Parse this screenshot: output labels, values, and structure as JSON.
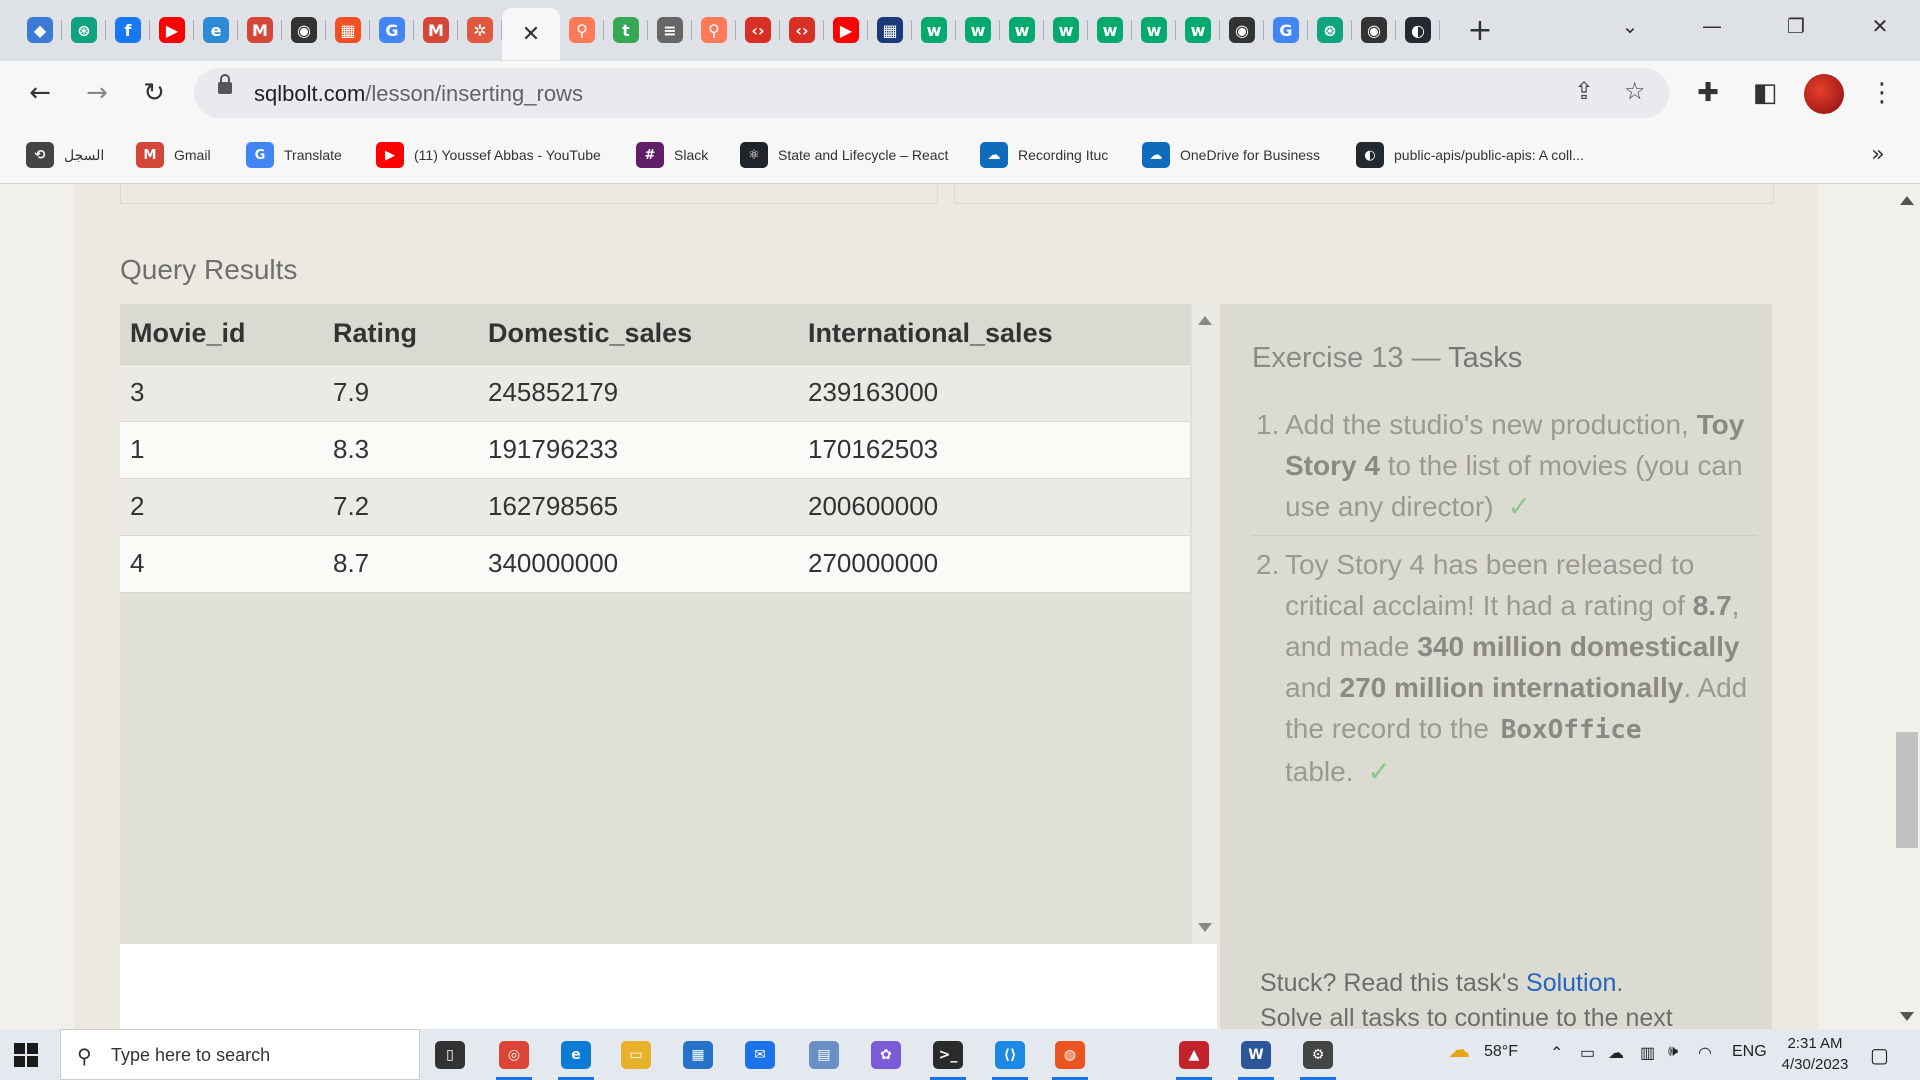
{
  "browser": {
    "tabs": [
      {
        "icon": "openai-icon",
        "color": "#3b7bd4",
        "glyph": "◆"
      },
      {
        "icon": "chatgpt-icon",
        "color": "#10a37f",
        "glyph": "⊛"
      },
      {
        "icon": "facebook-icon",
        "color": "#1877f2",
        "glyph": "f"
      },
      {
        "icon": "youtube-icon",
        "color": "#ff0000",
        "glyph": "▶"
      },
      {
        "icon": "edge-icon",
        "color": "#2d8bd6",
        "glyph": "e"
      },
      {
        "icon": "gmail-icon",
        "color": "#d44638",
        "glyph": "M"
      },
      {
        "icon": "globe-icon",
        "color": "#333333",
        "glyph": "◉"
      },
      {
        "icon": "microsoft-icon",
        "color": "#f25022",
        "glyph": "▦"
      },
      {
        "icon": "google-icon",
        "color": "#4285f4",
        "glyph": "G"
      },
      {
        "icon": "gmail-icon",
        "color": "#d44638",
        "glyph": "M"
      },
      {
        "icon": "settings-gear-icon",
        "color": "#e0593e",
        "glyph": "✲"
      }
    ],
    "tabs_after": [
      {
        "icon": "hubspot-icon",
        "color": "#ff7a59",
        "glyph": "⚲"
      },
      {
        "icon": "tumblr-icon",
        "color": "#35a853",
        "glyph": "t"
      },
      {
        "icon": "database-icon",
        "color": "#666666",
        "glyph": "≡"
      },
      {
        "icon": "hubspot-icon",
        "color": "#ff7a59",
        "glyph": "⚲"
      },
      {
        "icon": "code-shield-icon",
        "color": "#d93025",
        "glyph": "‹›"
      },
      {
        "icon": "code-shield-icon",
        "color": "#d93025",
        "glyph": "‹›"
      },
      {
        "icon": "youtube-icon",
        "color": "#ff0000",
        "glyph": "▶"
      },
      {
        "icon": "grid-icon",
        "color": "#1a3a7a",
        "glyph": "▦"
      },
      {
        "icon": "w3schools-icon",
        "color": "#04aa6d",
        "glyph": "w"
      },
      {
        "icon": "w3schools-icon",
        "color": "#04aa6d",
        "glyph": "w"
      },
      {
        "icon": "w3schools-icon",
        "color": "#04aa6d",
        "glyph": "w"
      },
      {
        "icon": "w3schools-icon",
        "color": "#04aa6d",
        "glyph": "w"
      },
      {
        "icon": "w3schools-icon",
        "color": "#04aa6d",
        "glyph": "w"
      },
      {
        "icon": "w3schools-icon",
        "color": "#04aa6d",
        "glyph": "w"
      },
      {
        "icon": "w3schools-icon",
        "color": "#04aa6d",
        "glyph": "w"
      },
      {
        "icon": "globe-icon",
        "color": "#333333",
        "glyph": "◉"
      },
      {
        "icon": "google-icon",
        "color": "#4285f4",
        "glyph": "G"
      },
      {
        "icon": "chatgpt-icon",
        "color": "#10a37f",
        "glyph": "⊛"
      },
      {
        "icon": "globe-icon",
        "color": "#333333",
        "glyph": "◉"
      },
      {
        "icon": "github-icon",
        "color": "#24292f",
        "glyph": "◐"
      }
    ],
    "active_tab_close": "✕",
    "new_tab": "+",
    "url_host": "sqlbolt.com",
    "url_path": "/lesson/inserting_rows",
    "bookmarks": [
      {
        "label": "السجل",
        "icon": "history-icon",
        "color": "#444444",
        "glyph": "⟲"
      },
      {
        "label": "Gmail",
        "icon": "gmail-icon",
        "color": "#d44638",
        "glyph": "M"
      },
      {
        "label": "Translate",
        "icon": "translate-icon",
        "color": "#4285f4",
        "glyph": "G"
      },
      {
        "label": "(11) Youssef Abbas - YouTube",
        "icon": "youtube-icon",
        "color": "#ff0000",
        "glyph": "▶"
      },
      {
        "label": "Slack",
        "icon": "slack-icon",
        "color": "#611f69",
        "glyph": "#"
      },
      {
        "label": "State and Lifecycle – React",
        "icon": "react-icon",
        "color": "#20232a",
        "glyph": "⚛"
      },
      {
        "label": "Recording Ituc",
        "icon": "onedrive-icon",
        "color": "#0f6cbd",
        "glyph": "☁"
      },
      {
        "label": "OneDrive for Business",
        "icon": "onedrive-icon",
        "color": "#0f6cbd",
        "glyph": "☁"
      },
      {
        "label": "public-apis/public-apis: A coll...",
        "icon": "github-icon",
        "color": "#24292f",
        "glyph": "◐"
      }
    ],
    "bookmarks_overflow": "»"
  },
  "query_results": {
    "title": "Query Results",
    "columns": [
      "Movie_id",
      "Rating",
      "Domestic_sales",
      "International_sales"
    ],
    "rows": [
      [
        "3",
        "7.9",
        "245852179",
        "239163000"
      ],
      [
        "1",
        "8.3",
        "191796233",
        "170162503"
      ],
      [
        "2",
        "7.2",
        "162798565",
        "200600000"
      ],
      [
        "4",
        "8.7",
        "340000000",
        "270000000"
      ]
    ]
  },
  "tasks": {
    "title_prefix": "Exercise 13 — ",
    "title_suffix": "Tasks",
    "task1": {
      "num": "1.",
      "t1": "Add the studio's new production, ",
      "b1": "Toy Story 4",
      "t2": " to the list of movies (you can use any director)",
      "check": "✓"
    },
    "task2": {
      "num": "2.",
      "t1": "Toy Story 4 has been released to critical acclaim! It had a rating of ",
      "b1": "8.7",
      "t2": ", and made ",
      "b2": "340 million domestically",
      "t3": " and ",
      "b3": "270 million internationally",
      "t4": ". Add the record to the ",
      "code": "BoxOffice",
      "t5": " table.",
      "check": "✓"
    },
    "stuck_prefix": "Stuck? Read this task's ",
    "stuck_link": "Solution",
    "stuck_suffix": ".",
    "stuck_line2": "Solve all tasks to continue to the next"
  },
  "taskbar": {
    "search_placeholder": "Type here to search",
    "weather": "58°F",
    "lang": "ENG",
    "time": "2:31 AM",
    "date": "4/30/2023",
    "apps": [
      {
        "icon": "task-view-icon",
        "color": "#333333",
        "glyph": "▯"
      },
      {
        "icon": "chrome-icon",
        "color": "#db4437",
        "glyph": "◎",
        "open": true
      },
      {
        "icon": "edge-icon",
        "color": "#0c7bd6",
        "glyph": "e",
        "open": true
      },
      {
        "icon": "file-explorer-icon",
        "color": "#e8b12c",
        "glyph": "▭"
      },
      {
        "icon": "store-icon",
        "color": "#2672c9",
        "glyph": "▦"
      },
      {
        "icon": "mail-icon",
        "color": "#1a73e8",
        "glyph": "✉"
      },
      {
        "icon": "network-icon",
        "color": "#6a8fc4",
        "glyph": "▤"
      },
      {
        "icon": "copilot-icon",
        "color": "#7b5bd6",
        "glyph": "✿"
      },
      {
        "icon": "terminal-icon",
        "color": "#2b2b2b",
        "glyph": ">_",
        "open": true
      },
      {
        "icon": "vscode-icon",
        "color": "#1e88e5",
        "glyph": "⟨⟩",
        "open": true
      },
      {
        "icon": "ubuntu-icon",
        "color": "#e95420",
        "glyph": "◍",
        "open": true
      },
      {
        "icon": "pdf-icon",
        "color": "#c3242b",
        "glyph": "▲",
        "open": true
      },
      {
        "icon": "word-icon",
        "color": "#2b579a",
        "glyph": "W",
        "open": true
      },
      {
        "icon": "settings-icon",
        "color": "#444444",
        "glyph": "⚙",
        "open": true
      }
    ]
  }
}
